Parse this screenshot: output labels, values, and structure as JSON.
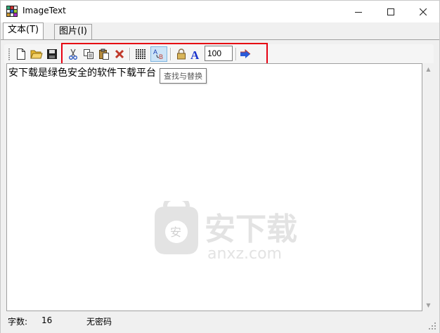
{
  "window": {
    "title": "ImageText"
  },
  "tabs": [
    {
      "label": "文本(T)"
    },
    {
      "label": "图片(I)"
    }
  ],
  "toolbar": {
    "zoom_value": "100"
  },
  "tooltip": {
    "text": "查找与替换"
  },
  "editor": {
    "text": "安下载是绿色安全的软件下载平台"
  },
  "watermark": {
    "brand": "安下载",
    "domain": "anxz.com"
  },
  "status": {
    "char_count_label": "字数:",
    "char_count": "16",
    "password_status": "无密码"
  },
  "colors": {
    "highlight": "#e60012",
    "text_bold_a": "#1a33cc",
    "cut_delete": "#c0392b",
    "arrow": "#2b5bd7"
  }
}
